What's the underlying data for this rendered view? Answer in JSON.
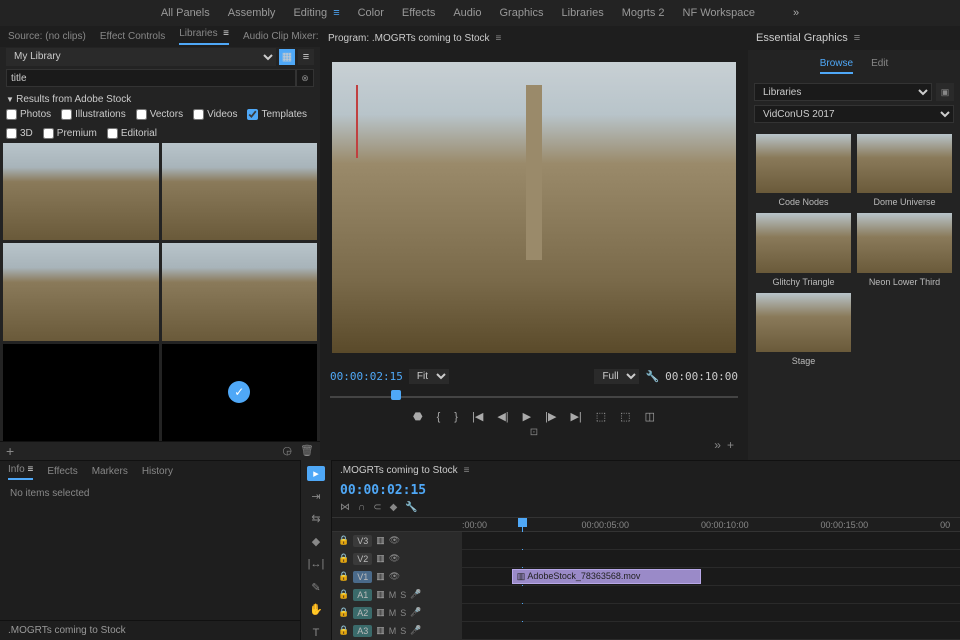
{
  "workspaces": {
    "items": [
      "All Panels",
      "Assembly",
      "Editing",
      "Color",
      "Effects",
      "Audio",
      "Graphics",
      "Libraries",
      "Mogrts 2",
      "NF Workspace"
    ],
    "active_index": 2
  },
  "source_panel": {
    "tabs": [
      "Source: (no clips)",
      "Effect Controls",
      "Libraries",
      "Audio Clip Mixer:"
    ],
    "active_index": 2,
    "library_name": "My Library",
    "search_value": "title",
    "stock_header": "Results from Adobe Stock",
    "filters": {
      "photos": "Photos",
      "illustrations": "Illustrations",
      "vectors": "Vectors",
      "videos": "Videos",
      "templates": "Templates",
      "threeD": "3D",
      "premium": "Premium",
      "editorial": "Editorial",
      "checked": "templates"
    }
  },
  "program": {
    "prefix": "Program: ",
    "sequence": ".MOGRTs coming to Stock",
    "timecode": "00:00:02:15",
    "fit": "Fit",
    "full": "Full",
    "duration": "00:00:10:00"
  },
  "essential_graphics": {
    "title": "Essential Graphics",
    "tabs": [
      "Browse",
      "Edit"
    ],
    "active_tab": 0,
    "lib_select": "Libraries",
    "sub_select": "VidConUS 2017",
    "items": [
      "Code Nodes",
      "Dome Universe",
      "Glitchy Triangle",
      "Neon Lower Third",
      "Stage"
    ]
  },
  "info_panel": {
    "tabs": [
      "Info",
      "Effects",
      "Markers",
      "History"
    ],
    "active_index": 0,
    "body": "No items selected",
    "footer": ".MOGRTs coming to Stock"
  },
  "timeline": {
    "sequence": ".MOGRTs coming to Stock",
    "timecode": "00:00:02:15",
    "ruler": [
      ":00:00",
      "00:00:05:00",
      "00:00:10:00",
      "00:00:15:00",
      "00"
    ],
    "tracks": {
      "v3": "V3",
      "v2": "V2",
      "v1": "V1",
      "a1": "A1",
      "a2": "A2",
      "a3": "A3",
      "m": "M",
      "s": "S"
    },
    "clip": {
      "name": "AdobeStock_78363568.mov",
      "left_pct": 10,
      "width_pct": 38
    }
  }
}
